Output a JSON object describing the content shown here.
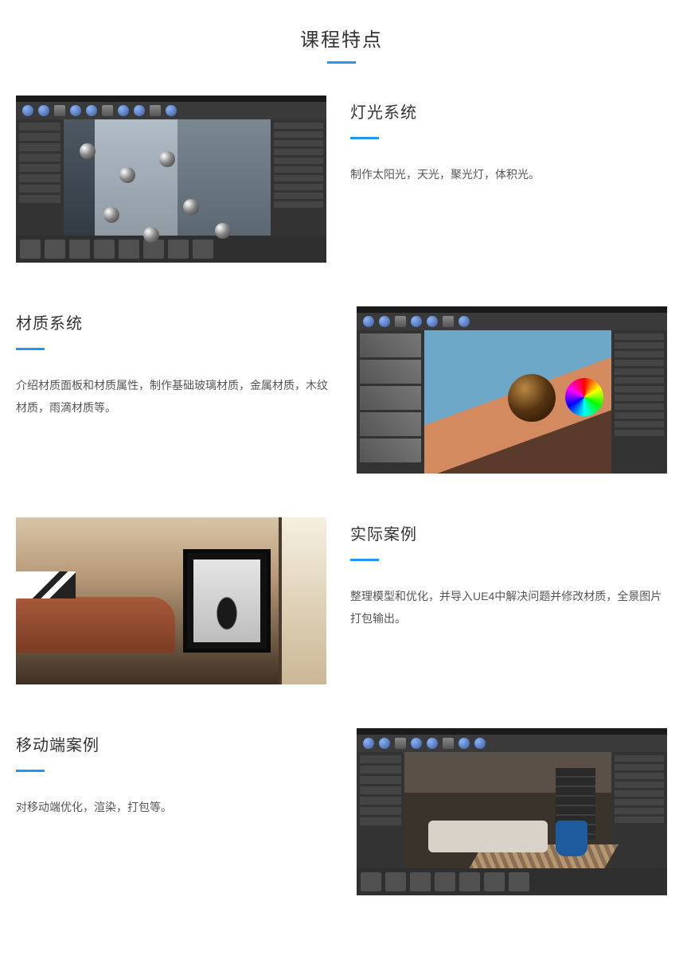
{
  "page": {
    "title": "课程特点"
  },
  "features": [
    {
      "title": "灯光系统",
      "desc": "制作太阳光，天光，聚光灯，体积光。",
      "image_alt": "UE4 编辑器 — 室内场景灯光系统截图"
    },
    {
      "title": "材质系统",
      "desc": "介绍材质面板和材质属性，制作基础玻璃材质，金属材质，木纹材质，雨滴材质等。",
      "image_alt": "UE4 材质编辑器 — 颜色拾取器与材质球"
    },
    {
      "title": "实际案例",
      "desc": "整理模型和优化，并导入UE4中解决问题并修改材质，全景图片打包输出。",
      "image_alt": "室内渲染 — 皮沙发与黑白相框"
    },
    {
      "title": "移动端案例",
      "desc": "对移动端优化，渲染，打包等。",
      "image_alt": "UE4 编辑器 — 现代客厅移动端渲染"
    }
  ]
}
